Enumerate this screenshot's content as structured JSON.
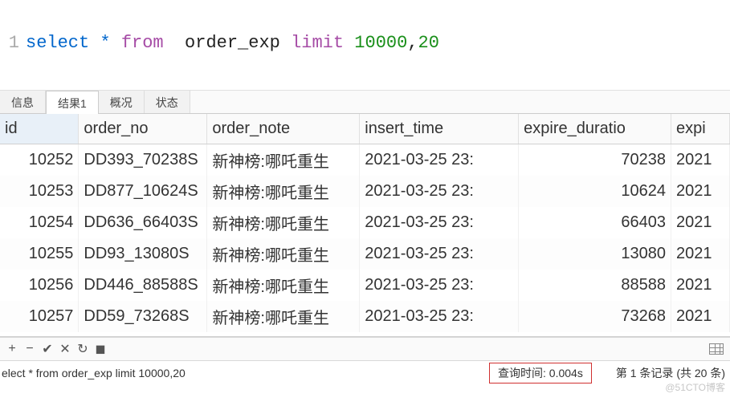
{
  "sql": {
    "line_number": "1",
    "tokens": {
      "select": "select",
      "star": "*",
      "from": "from",
      "table": "order_exp",
      "limit": "limit",
      "offset": "10000",
      "comma": ",",
      "count": "20"
    }
  },
  "tabs": {
    "info": "信息",
    "result1": "结果1",
    "profile": "概况",
    "status": "状态"
  },
  "columns": {
    "id": "id",
    "order_no": "order_no",
    "order_note": "order_note",
    "insert_time": "insert_time",
    "expire_duration": "expire_duratio",
    "expire": "expi"
  },
  "rows": [
    {
      "id": "10252",
      "order_no": "DD393_70238S",
      "order_note": "新神榜:哪吒重生",
      "insert_time": "2021-03-25 23:",
      "expire_duration": "70238",
      "expire": "2021"
    },
    {
      "id": "10253",
      "order_no": "DD877_10624S",
      "order_note": "新神榜:哪吒重生",
      "insert_time": "2021-03-25 23:",
      "expire_duration": "10624",
      "expire": "2021"
    },
    {
      "id": "10254",
      "order_no": "DD636_66403S",
      "order_note": "新神榜:哪吒重生",
      "insert_time": "2021-03-25 23:",
      "expire_duration": "66403",
      "expire": "2021"
    },
    {
      "id": "10255",
      "order_no": "DD93_13080S",
      "order_note": "新神榜:哪吒重生",
      "insert_time": "2021-03-25 23:",
      "expire_duration": "13080",
      "expire": "2021"
    },
    {
      "id": "10256",
      "order_no": "DD446_88588S",
      "order_note": "新神榜:哪吒重生",
      "insert_time": "2021-03-25 23:",
      "expire_duration": "88588",
      "expire": "2021"
    },
    {
      "id": "10257",
      "order_no": "DD59_73268S",
      "order_note": "新神榜:哪吒重生",
      "insert_time": "2021-03-25 23:",
      "expire_duration": "73268",
      "expire": "2021"
    }
  ],
  "status": {
    "query_echo": "elect * from  order_exp limit 10000,20",
    "query_time_label": "查询时间: 0.004s",
    "record_count": "第 1 条记录 (共 20 条)"
  },
  "watermark": "@51CTO博客"
}
